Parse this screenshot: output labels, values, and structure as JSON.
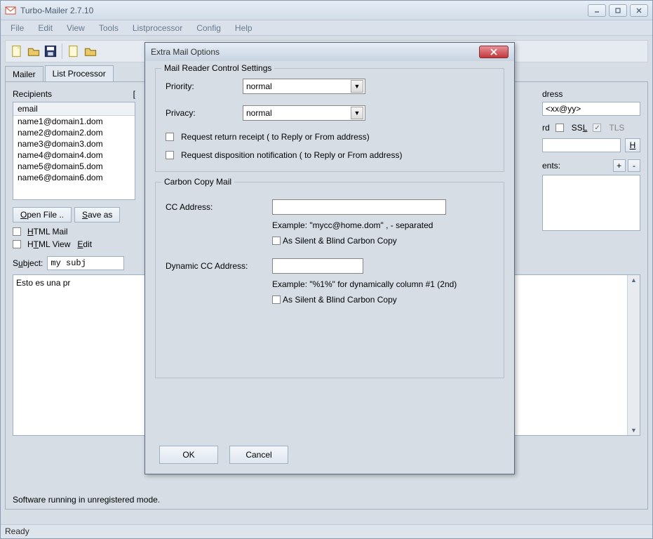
{
  "window": {
    "title": "Turbo-Mailer 2.7.10"
  },
  "menubar": [
    "File",
    "Edit",
    "View",
    "Tools",
    "Listprocessor",
    "Config",
    "Help"
  ],
  "tabs": {
    "mailer": "Mailer",
    "listproc": "List Processor"
  },
  "main": {
    "recipients_label": "Recipients",
    "email_header": "email",
    "emails": [
      "name1@domain1.dom",
      "name2@domain2.dom",
      "name3@domain3.dom",
      "name4@domain4.dom",
      "name5@domain5.dom",
      "name6@domain6.dom"
    ],
    "open_file": "Open File ..",
    "save_as": "Save as",
    "html_mail": "HTML Mail",
    "html_view": "HTML View",
    "edit": "Edit",
    "subject_label": "Subject:",
    "subject_value": "my subj",
    "body_text": "Esto es una pr"
  },
  "right": {
    "address_label": "dress",
    "address_value": "<xx@yy>",
    "rd_label": "rd",
    "ssl_label": "SSL",
    "tls_label": "TLS",
    "h_btn": "H",
    "ents_label": "ents:"
  },
  "status": {
    "unregistered": "Software running in unregistered mode.",
    "ready": "Ready"
  },
  "dialog": {
    "title": "Extra Mail Options",
    "group1": {
      "legend": "Mail Reader Control Settings",
      "priority_label": "Priority:",
      "priority_value": "normal",
      "privacy_label": "Privacy:",
      "privacy_value": "normal",
      "request_receipt": "Request return receipt  ( to Reply or From address)",
      "request_disposition": "Request disposition notification  ( to Reply or From address)"
    },
    "group2": {
      "legend": "Carbon Copy Mail",
      "cc_label": "CC Address:",
      "cc_hint": "Example: \"mycc@home.dom\"     , - separated",
      "cc_silent": "As Silent & Blind Carbon Copy",
      "dyn_label": "Dynamic CC Address:",
      "dyn_hint": "Example: \"%1%\" for dynamically column #1 (2nd)",
      "dyn_silent": "As Silent & Blind Carbon Copy"
    },
    "ok": "OK",
    "cancel": "Cancel"
  }
}
